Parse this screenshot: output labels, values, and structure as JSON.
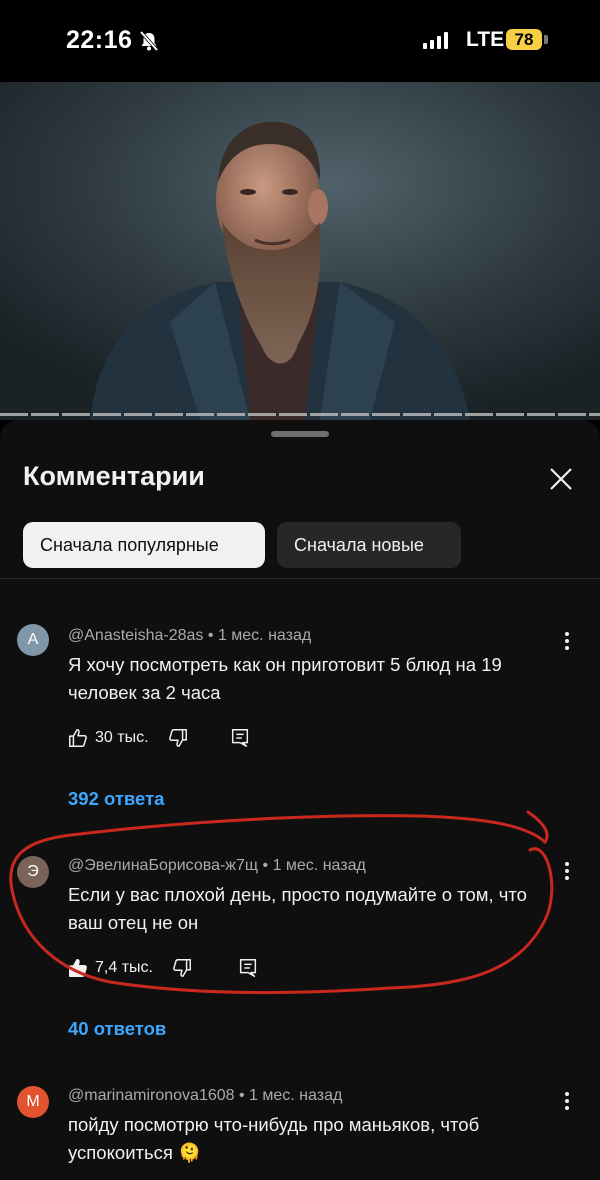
{
  "status_bar": {
    "time": "22:16",
    "network": "LTE",
    "battery": "78"
  },
  "sheet": {
    "title": "Комментарии",
    "sort_chips": [
      {
        "label": "Сначала популярные",
        "active": true
      },
      {
        "label": "Сначала новые",
        "active": false
      }
    ]
  },
  "comments": [
    {
      "avatar_letter": "A",
      "avatar_color": "#8097a9",
      "author": "@Anasteisha-28as",
      "time": "1 мес. назад",
      "text": "Я хочу посмотреть как он приготовит 5 блюд на 19 человек за 2 часа",
      "likes": "30 тыс.",
      "replies": "392 ответа"
    },
    {
      "avatar_letter": "Э",
      "avatar_color": "#7a6358",
      "author": "@ЭвелинаБорисова-ж7щ",
      "time": "1 мес. назад",
      "text": "Если у вас плохой день, просто подумайте о том, что ваш отец не он",
      "likes": "7,4 тыс.",
      "replies": "40 ответов"
    },
    {
      "avatar_letter": "M",
      "avatar_color": "#e1532e",
      "author": "@marinamironova1608",
      "time": "1 мес. назад",
      "text": "пойду посмотрю что-нибудь про маньяков, чтоб успокоиться 🫠"
    }
  ],
  "annotation": {
    "color": "#c8281e"
  }
}
